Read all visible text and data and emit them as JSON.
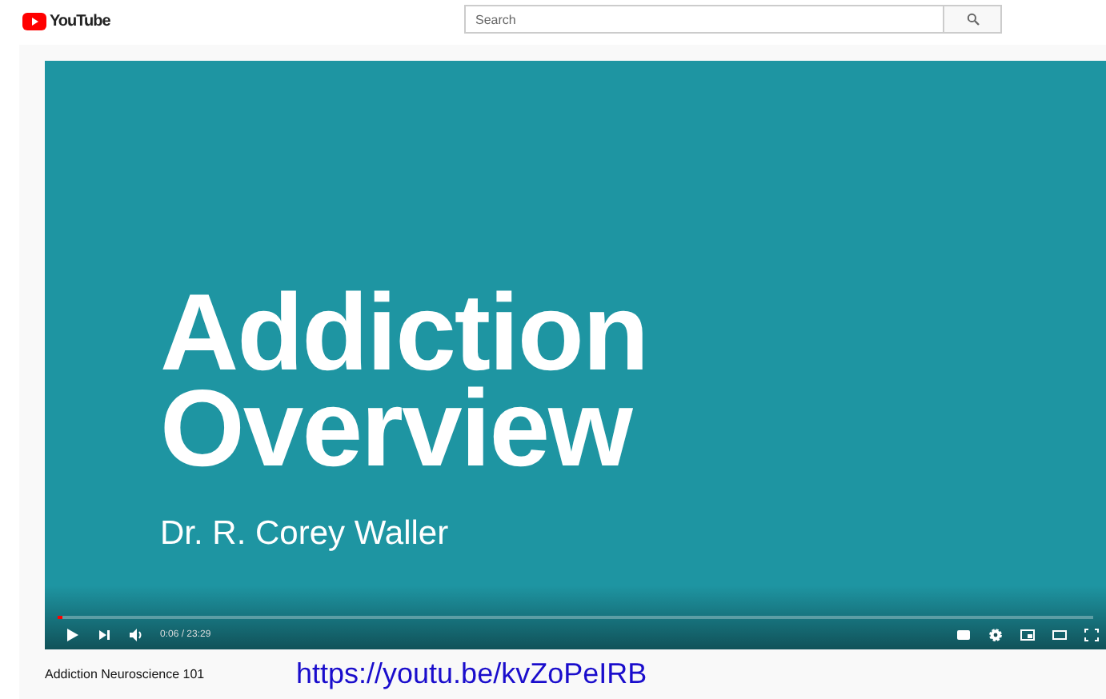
{
  "header": {
    "logo": "YouTube",
    "search": {
      "placeholder": "Search"
    }
  },
  "video": {
    "title_lines": [
      "Addiction",
      "Overview"
    ],
    "subtitle": "Dr. R. Corey Waller",
    "progress": {
      "level": 0.005
    },
    "time": "0:06 / 23:29"
  },
  "video_title": "Addiction Neuroscience 101",
  "link": "https://youtu.be/kvZoPeIRB"
}
